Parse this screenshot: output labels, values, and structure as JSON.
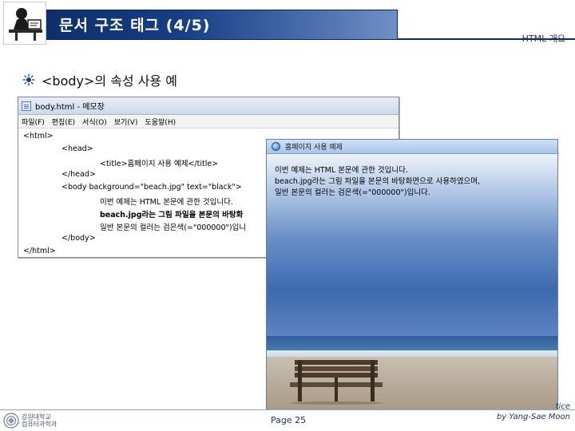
{
  "slide": {
    "title": "문서 구조 태그 (4/5)",
    "section": "HTML 개요",
    "bullet": "<body>의 속성 사용 예"
  },
  "notepad": {
    "title": "body.html - 메모장",
    "menus": [
      "파일(F)",
      "편집(E)",
      "서식(O)",
      "보기(V)",
      "도움말(H)"
    ],
    "code_lines": [
      "<html>",
      "<head>",
      "<title>홈페이지 사용 예제</title>",
      "</head>",
      "<body background=\"beach.jpg\" text=\"black\">",
      "이번 예제는 HTML 본문에 관한 것입니다.",
      "beach.jpg라는 그림 파일을 본문의 바탕화",
      "일반 본문의 컬러는 검은색(=\"000000\")입니",
      "</body>",
      "</html>"
    ]
  },
  "browser": {
    "title": "홈페이지 사용 예제",
    "text_lines": [
      "이번 예제는 HTML 본문에 관한 것입니다.",
      "beach.jpg라는 그림 파일을 본문의 바탕화면으로 사용하였으며,",
      "일반 본문의 컬러는 검은색(=\"000000\")입니다."
    ]
  },
  "footer": {
    "page": "Page 25",
    "credit_line1": "tice",
    "credit_line2": "by Yang-Sae Moon",
    "logo_text_line1": "강원대학교",
    "logo_text_line2": "컴퓨터과학과"
  },
  "colors": {
    "title_bar": "#163f86",
    "footer_text": "#223366"
  }
}
